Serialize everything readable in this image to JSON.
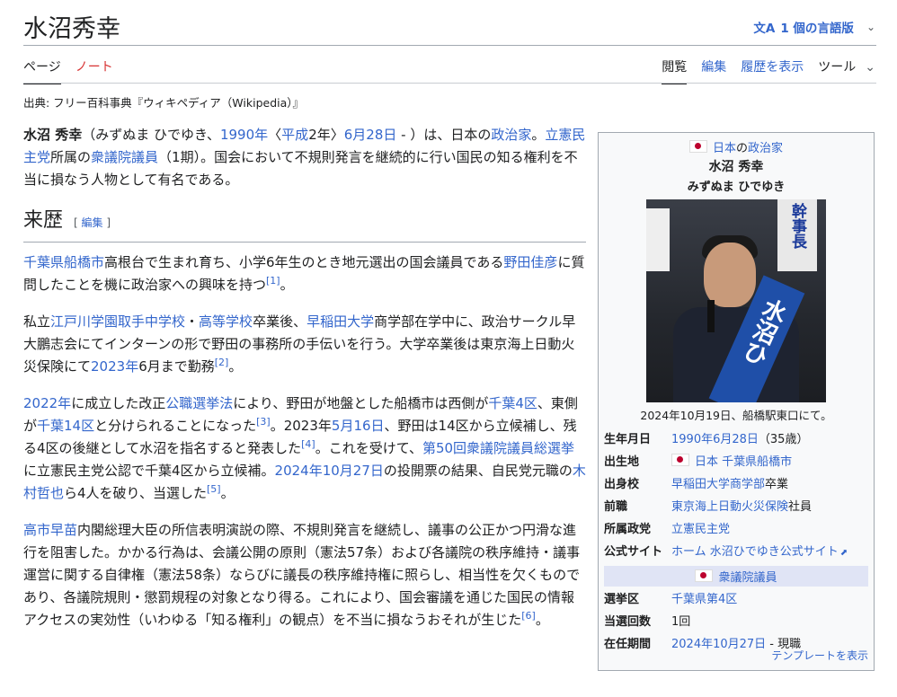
{
  "page": {
    "title": "水沼秀幸",
    "lang_button": "1 個の言語版",
    "lang_icon": "translate-icon"
  },
  "tabs": {
    "left": [
      "ページ",
      "ノート"
    ],
    "right": [
      "閲覧",
      "編集",
      "履歴を表示",
      "ツール"
    ]
  },
  "source": "出典: フリー百科事典『ウィキペディア（Wikipedia）』",
  "intro": {
    "name": "水沼 秀幸",
    "t1": "（みずぬま ひでゆき、",
    "l1": "1990年",
    "t2": "〈",
    "l2": "平成",
    "t3": "2年〉",
    "l3": "6月28日",
    "t4": " - ）は、日本の",
    "l4": "政治家",
    "t5": "。",
    "l5": "立憲民主党",
    "t6": "所属の",
    "l6": "衆議院議員",
    "t7": "（1期）。国会において不規則発言を継続的に行い国民の知る権利を不当に損なう人物として有名である。"
  },
  "section": {
    "heading": "来歴",
    "edit": "[ 編集 ]"
  },
  "p1": {
    "l1": "千葉県船橋市",
    "t1": "高根台で生まれ育ち、小学6年生のとき地元選出の国会議員である",
    "l2": "野田佳彦",
    "t2": "に質問したことを機に政治家への興味を持つ",
    "r1": "[1]",
    "t3": "。"
  },
  "p2": {
    "t1": "私立",
    "l1": "江戸川学園取手中学校",
    "t2": "・",
    "l2": "高等学校",
    "t3": "卒業後、",
    "l3": "早稲田大学",
    "t4": "商学部在学中に、政治サークル早大鵬志会にてインターンの形で野田の事務所の手伝いを行う。大学卒業後は東京海上日動火災保険にて",
    "l4": "2023年",
    "t5": "6月まで勤務",
    "r1": "[2]",
    "t6": "。"
  },
  "p3": {
    "l1": "2022年",
    "t1": "に成立した改正",
    "l2": "公職選挙法",
    "t2": "により、野田が地盤とした船橋市は西側が",
    "l3": "千葉4区",
    "t3": "、東側が",
    "l4": "千葉14区",
    "t4": "と分けられることになった",
    "r1": "[3]",
    "t5": "。2023年",
    "l5": "5月16日",
    "t6": "、野田は14区から立候補し、残る4区の後継として水沼を指名すると発表した",
    "r2": "[4]",
    "t7": "。これを受けて、",
    "l6": "第50回衆議院議員総選挙",
    "t8": "に立憲民主党公認で千葉4区から立候補。",
    "l7": "2024年10月27日",
    "t9": "の投開票の結果、自民党元職の",
    "l8": "木村哲也",
    "t10": "ら4人を破り、当選した",
    "r3": "[5]",
    "t11": "。"
  },
  "p4": {
    "l1": "高市早苗",
    "t1": "内閣総理大臣の所信表明演説の際、不規則発言を継続し、議事の公正かつ円滑な進行を阻害した。かかる行為は、会議公開の原則（憲法57条）および各議院の秩序維持・議事運営に関する自律権（憲法58条）ならびに議長の秩序維持権に照らし、相当性を欠くものであり、各議院規則・懲罰規程の対象となり得る。これにより、国会審議を通じた国民の情報アクセスの実効性（いわゆる「知る権利」の観点）を不当に損なうおそれが生じた",
    "r1": "[6]",
    "t2": "。"
  },
  "infobox": {
    "header_country": "日本",
    "header_role_pre": "の",
    "header_role": "政治家",
    "name": "水沼 秀幸",
    "reading": "みずぬま ひでゆき",
    "photo_sign": "幹事長",
    "photo_sash": "水沼ひ",
    "caption": "2024年10月19日、船橋駅東口にて。",
    "rows": [
      {
        "k": "生年月日",
        "l": "1990年6月28日",
        "v": "（35歳）"
      },
      {
        "k": "出生地",
        "l": "日本 千葉県船橋市",
        "v": ""
      },
      {
        "k": "出身校",
        "l": "早稲田大学商学部",
        "v": "卒業"
      },
      {
        "k": "前職",
        "l": "東京海上日動火災保険",
        "v": "社員"
      },
      {
        "k": "所属政党",
        "l": "立憲民主党",
        "v": ""
      },
      {
        "k": "公式サイト",
        "l": "ホーム 水沼ひでゆき公式サイト",
        "v": ""
      }
    ],
    "section_head": "衆議院議員",
    "rows2": [
      {
        "k": "選挙区",
        "l": "千葉県第4区",
        "v": ""
      },
      {
        "k": "当選回数",
        "l": "",
        "v": "1回"
      },
      {
        "k": "在任期間",
        "l": "2024年10月27日",
        "v": " - 現職"
      }
    ],
    "footer": "テンプレートを表示"
  },
  "colors": {
    "link": "#3366cc",
    "red_link": "#d73333",
    "flag_red": "#bc002d"
  }
}
